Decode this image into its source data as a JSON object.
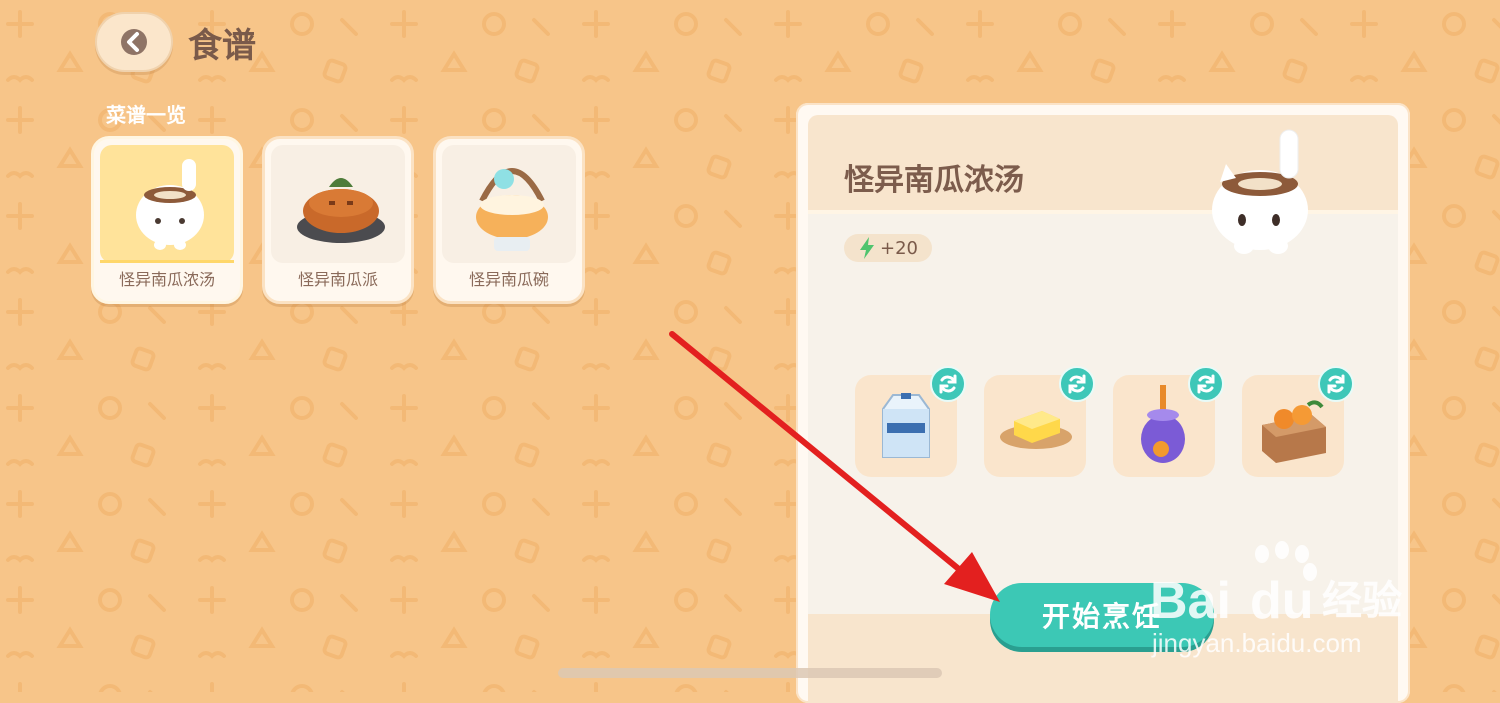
{
  "header": {
    "title": "食谱"
  },
  "recipe_list": {
    "label": "菜谱一览",
    "items": [
      {
        "name": "怪异南瓜浓汤",
        "selected": true
      },
      {
        "name": "怪异南瓜派",
        "selected": false
      },
      {
        "name": "怪异南瓜碗",
        "selected": false
      }
    ]
  },
  "detail": {
    "title": "怪异南瓜浓汤",
    "energy": "+20",
    "ingredients": [
      {
        "icon": "milk-carton-icon"
      },
      {
        "icon": "butter-icon"
      },
      {
        "icon": "potion-jar-icon"
      },
      {
        "icon": "pumpkin-crate-icon"
      }
    ],
    "cook_button": "开始烹饪"
  },
  "watermark": {
    "brand": "Bai",
    "brand2": "du",
    "suffix": "经验",
    "url": "jingyan.baidu.com"
  },
  "colors": {
    "accent": "#3cc8b5",
    "background": "#f7c589",
    "title": "#7a5a4a"
  }
}
